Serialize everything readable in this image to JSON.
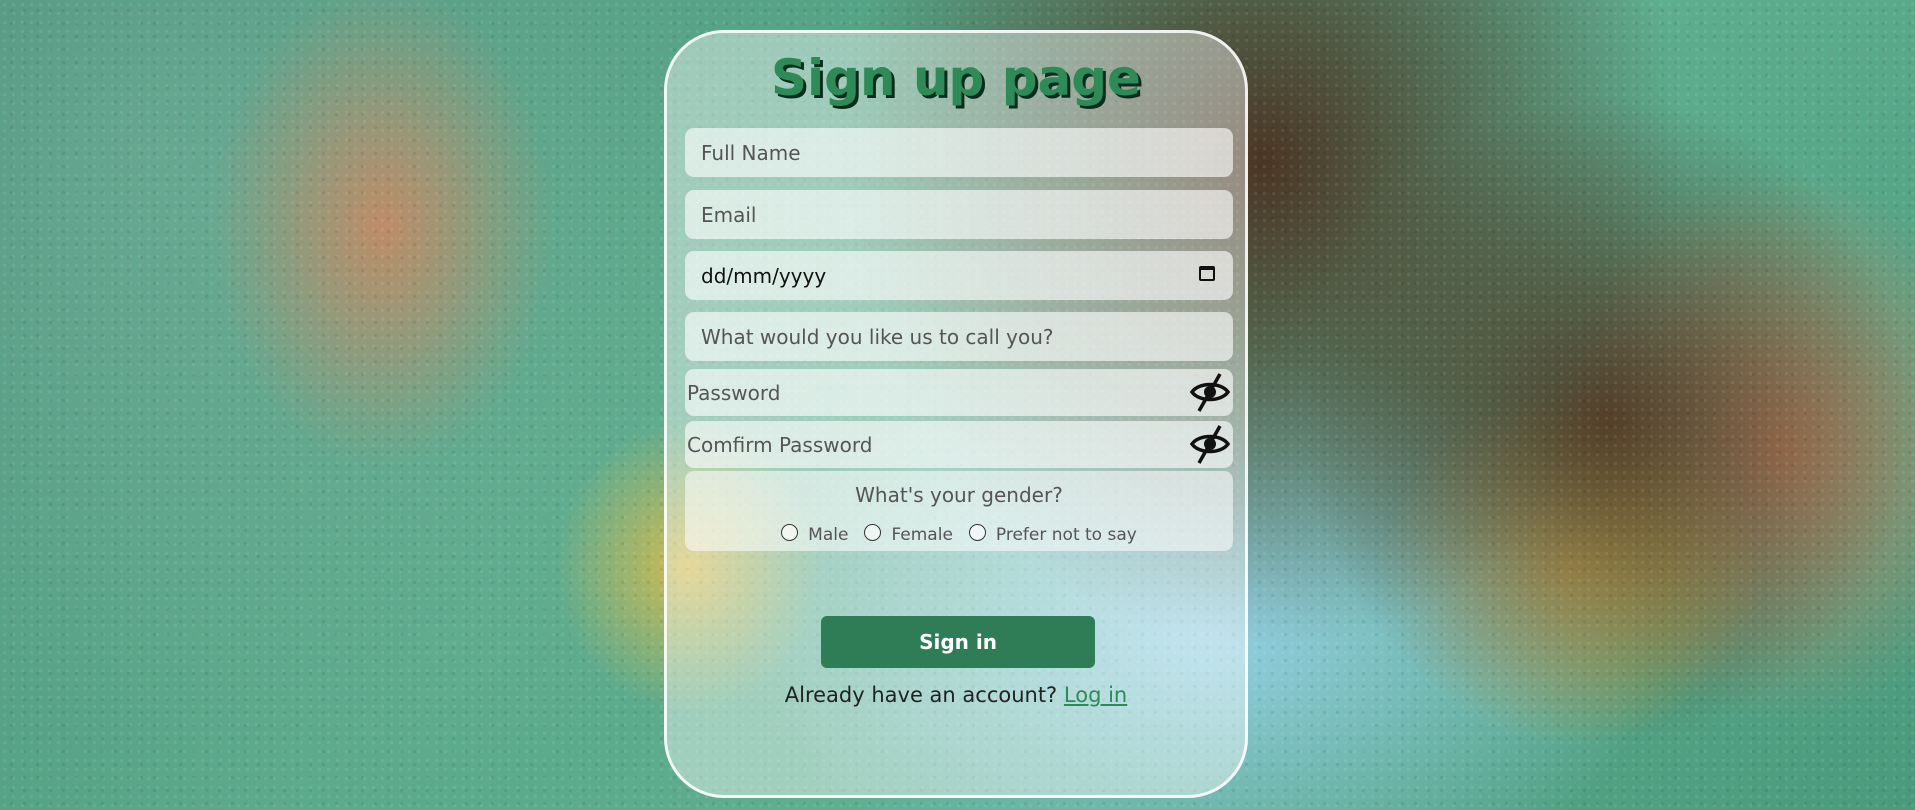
{
  "page": {
    "title": "Sign up page"
  },
  "form": {
    "full_name_placeholder": "Full Name",
    "email_placeholder": "Email",
    "date_value": "dd/mm/yyyy",
    "nickname_placeholder": "What would you like us to call you?",
    "password_placeholder": "Password",
    "confirm_password_placeholder": "Comfirm Password",
    "gender": {
      "question": "What's your gender?",
      "options": [
        "Male",
        "Female",
        "Prefer not to say"
      ]
    }
  },
  "actions": {
    "sign_in_label": "Sign in",
    "login_prompt": "Already have an account?",
    "login_link": "Log in"
  },
  "colors": {
    "accent": "#2e8b57",
    "button": "#2e7d57"
  },
  "icons": [
    "calendar-icon",
    "eye-slash-icon"
  ]
}
